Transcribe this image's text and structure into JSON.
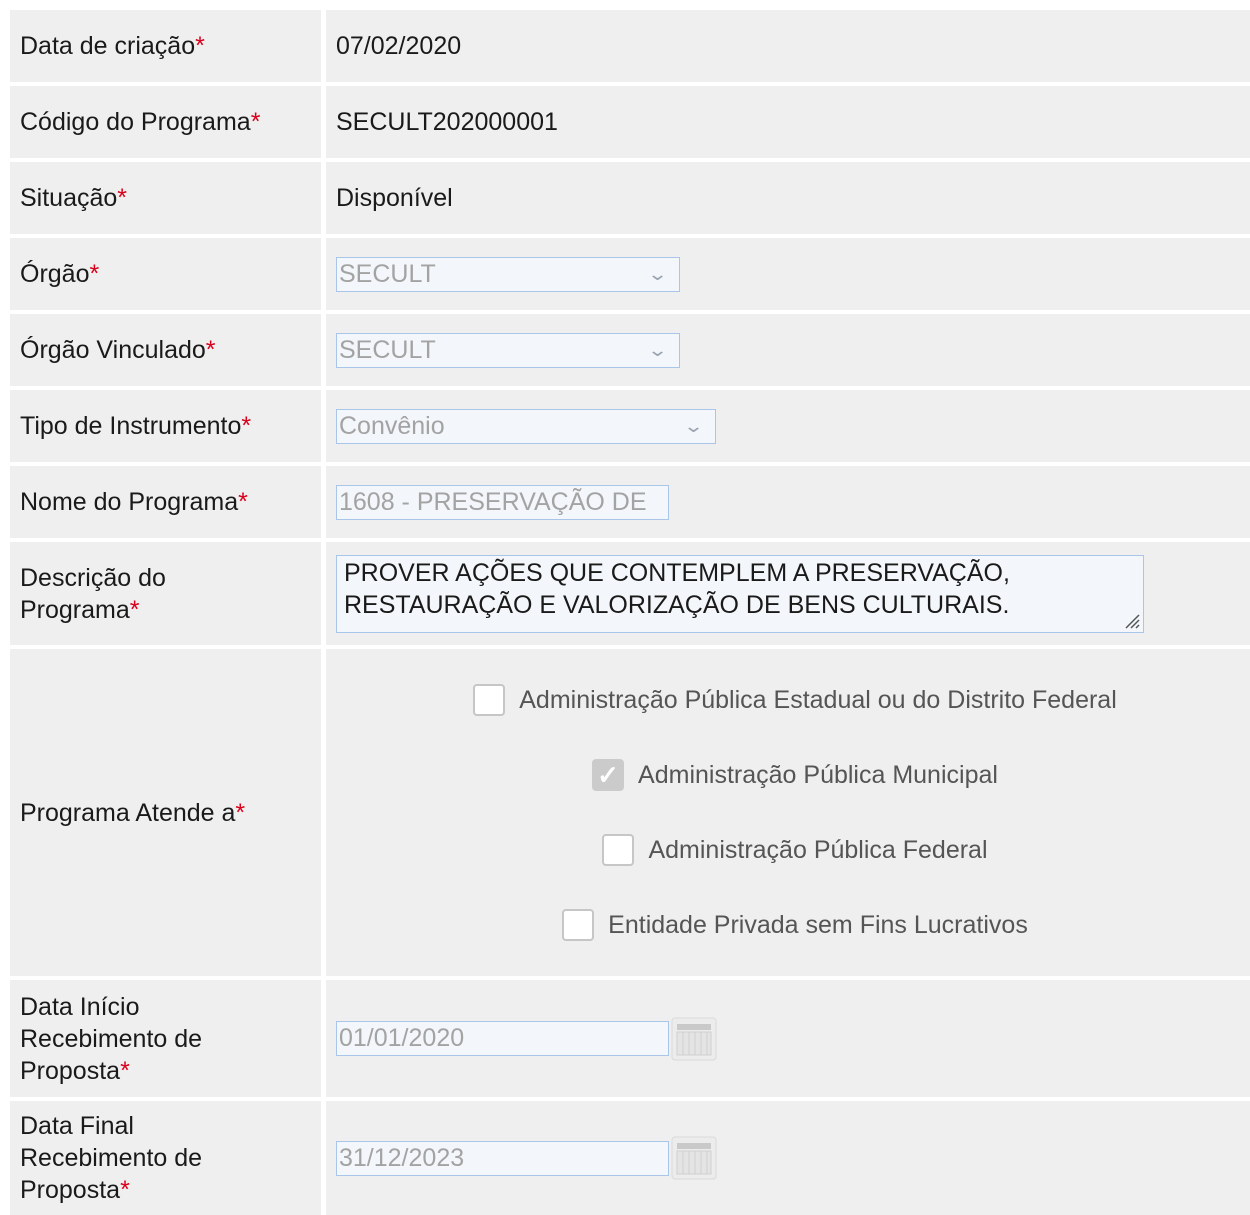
{
  "fields": {
    "data_criacao": {
      "label": "Data de criação",
      "value": "07/02/2020"
    },
    "codigo_programa": {
      "label": "Código do Programa",
      "value": "SECULT202000001"
    },
    "situacao": {
      "label": "Situação",
      "value": "Disponível"
    },
    "orgao": {
      "label": "Órgão",
      "value": "SECULT",
      "icon": "chevron-down-icon"
    },
    "orgao_vinculado": {
      "label": "Órgão Vinculado",
      "value": "SECULT",
      "icon": "chevron-down-icon"
    },
    "tipo_instrumento": {
      "label": "Tipo de Instrumento",
      "value": "Convênio",
      "icon": "chevron-down-icon"
    },
    "nome_programa": {
      "label": "Nome do Programa",
      "value": "1608 - PRESERVAÇÃO DE"
    },
    "descricao_programa": {
      "label_line1": "Descrição do",
      "label_line2": "Programa",
      "value_line1": "PROVER AÇÕES QUE CONTEMPLEM A PRESERVAÇÃO,",
      "value_line2": "RESTAURAÇÃO E VALORIZAÇÃO DE BENS CULTURAIS."
    },
    "programa_atende": {
      "label": "Programa Atende a",
      "options": [
        {
          "label": "Administração Pública Estadual ou do Distrito Federal",
          "checked": false
        },
        {
          "label": "Administração Pública Municipal",
          "checked": true
        },
        {
          "label": "Administração Pública Federal",
          "checked": false
        },
        {
          "label": "Entidade Privada sem Fins Lucrativos",
          "checked": false
        }
      ]
    },
    "data_inicio": {
      "label_line1": "Data Início",
      "label_line2": "Recebimento de",
      "label_line3": "Proposta",
      "value": "01/01/2020",
      "icon": "calendar-icon"
    },
    "data_final": {
      "label_line1": "Data Final",
      "label_line2": "Recebimento de",
      "label_line3": "Proposta",
      "value": "31/12/2023",
      "icon": "calendar-icon"
    }
  },
  "required_marker": "*",
  "colors": {
    "required": "#d9001b",
    "row_bg": "#efefef",
    "input_border": "#a9c6ea"
  }
}
